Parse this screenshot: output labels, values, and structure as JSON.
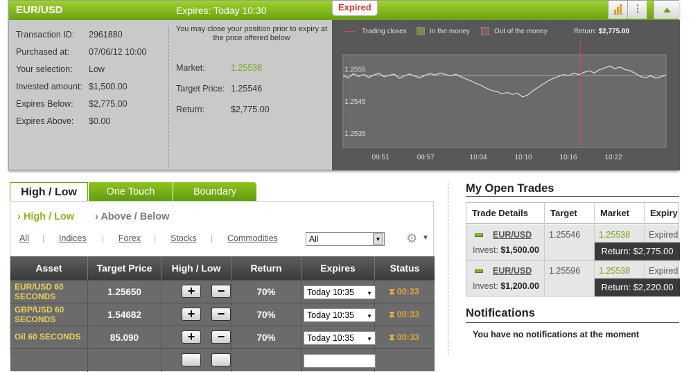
{
  "header": {
    "pair": "EUR/USD",
    "expires": "Expires:  Today 10:30",
    "badge": "Expired"
  },
  "transaction": {
    "rows": [
      {
        "label": "Transaction ID:",
        "value": "2961880"
      },
      {
        "label": "Purchased at:",
        "value": "07/06/12 10:00"
      },
      {
        "label": "Your selection:",
        "value": "Low"
      },
      {
        "label": "Invested amount:",
        "value": "$1,500.00"
      },
      {
        "label": "Expires Below:",
        "value": "$2,775.00"
      },
      {
        "label": "Expires Above:",
        "value": "$0.00"
      }
    ]
  },
  "close_note": "You may close your position prior to expiry at the price offered below",
  "market_info": {
    "market_label": "Market:",
    "market_value": "1.25538",
    "target_label": "Target Price:",
    "target_value": "1.25546",
    "return_label": "Return:",
    "return_value": "$2,775.00"
  },
  "chart_data": {
    "type": "line",
    "legend": {
      "trading_closes": "Trading closes",
      "in_money": "In the money",
      "out_money": "Out of the money",
      "return_label": "Return:",
      "return_value": "$2,775.00"
    },
    "y_ticks": [
      "1.2555",
      "1.2545",
      "1.2535"
    ],
    "x_ticks": [
      "09:51",
      "09:57",
      "10:04",
      "10:10",
      "10:16",
      "10:22"
    ],
    "ylim": [
      1.2532,
      1.2561
    ],
    "target_line": 1.25546,
    "expiry_x": 31.6,
    "x_range": [
      0,
      43
    ],
    "series_y": [
      1.25545,
      1.25538,
      1.25551,
      1.25542,
      1.25548,
      1.25539,
      1.25547,
      1.25552,
      1.25541,
      1.25546,
      1.25549,
      1.25536,
      1.25544,
      1.2555,
      1.25543,
      1.25538,
      1.25546,
      1.25551,
      1.25547,
      1.25553,
      1.25548,
      1.25544,
      1.25549,
      1.25541,
      1.25534,
      1.25528,
      1.2552,
      1.25514,
      1.25505,
      1.25498,
      1.25495,
      1.25488,
      1.25492,
      1.25486,
      1.2549,
      1.25478,
      1.25484,
      1.25497,
      1.25508,
      1.25518,
      1.25528,
      1.25536,
      1.25542,
      1.25548,
      1.25545,
      1.25552,
      1.25548,
      1.25555,
      1.2556,
      1.25553,
      1.25563,
      1.25568,
      1.25575,
      1.25566,
      1.25572,
      1.25564,
      1.2556,
      1.25552,
      1.25542,
      1.25538,
      1.25544,
      1.25537,
      1.25541,
      1.25546
    ]
  },
  "tabs": {
    "active": "High / Low",
    "one_touch": "One Touch",
    "boundary": "Boundary"
  },
  "subtabs": {
    "high_low": "› High / Low",
    "above_below": "› Above / Below"
  },
  "filters": {
    "links": [
      "All",
      "Indices",
      "Forex",
      "Stocks",
      "Commodities"
    ],
    "select_value": "All"
  },
  "asset_table": {
    "headers": [
      "Asset",
      "Target Price",
      "High / Low",
      "Return",
      "Expires",
      "Status"
    ],
    "rows": [
      {
        "asset": "EUR/USD 60 SECONDS",
        "price": "1.25650",
        "ret": "70%",
        "expires": "Today 10:35",
        "status": "00:33"
      },
      {
        "asset": "GBP/USD 60 SECONDS",
        "price": "1.54682",
        "ret": "70%",
        "expires": "Today 10:35",
        "status": "00:33"
      },
      {
        "asset": "Oil 60 SECONDS",
        "price": "85.090",
        "ret": "70%",
        "expires": "Today 10:35",
        "status": "00:33"
      }
    ],
    "plus": "+",
    "minus": "−"
  },
  "open_trades": {
    "title": "My Open Trades",
    "headers": [
      "Trade Details",
      "Target",
      "Market",
      "Expiry"
    ],
    "rows": [
      {
        "pair": "EUR/USD",
        "invest_label": "Invest:",
        "invest": "$1,500.00",
        "target": "1.25546",
        "market": "1.25538",
        "expiry": "Expired",
        "return": "Return: $2,775.00"
      },
      {
        "pair": "EUR/USD",
        "invest_label": "Invest:",
        "invest": "$1,200.00",
        "target": "1.25596",
        "market": "1.25538",
        "expiry": "Expired",
        "return": "Return: $2,220.00"
      }
    ]
  },
  "notifications": {
    "title": "Notifications",
    "message": "You have no notifications at the moment"
  },
  "colors": {
    "brand_green": "#7ab317",
    "expired_red": "#d23a2a",
    "chart_bg": "#585858",
    "table_row": "#6b6b6b"
  }
}
